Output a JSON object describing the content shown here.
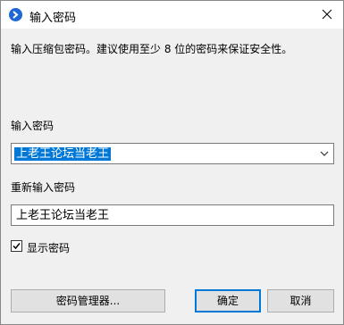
{
  "window": {
    "title": "输入密码",
    "icon": "app-logo-icon"
  },
  "description": "输入压缩包密码。建议使用至少 8 位的密码来保证安全性。",
  "password": {
    "label": "输入密码",
    "value": "上老王论坛当老王"
  },
  "confirm": {
    "label": "重新输入密码",
    "value": "上老王论坛当老王"
  },
  "show_password": {
    "label": "显示密码",
    "checked": true
  },
  "buttons": {
    "manager": "密码管理器...",
    "ok": "确定",
    "cancel": "取消"
  },
  "colors": {
    "accent": "#0078d7",
    "icon_blue": "#1f66d6"
  }
}
